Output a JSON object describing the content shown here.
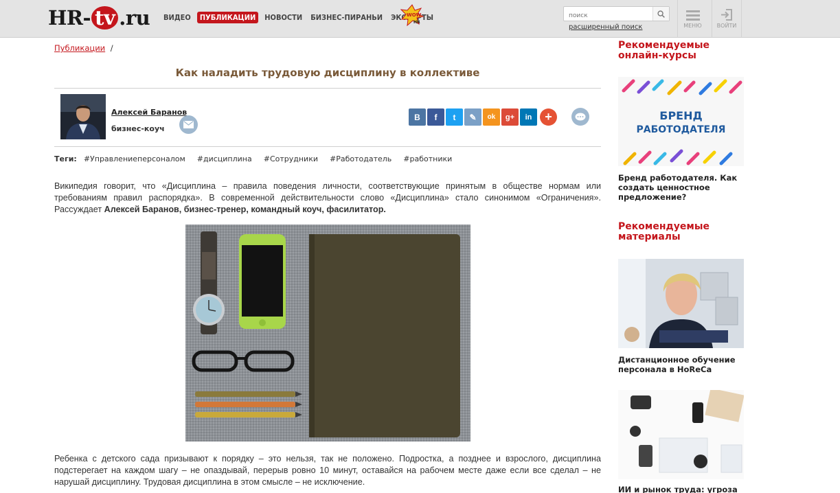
{
  "header": {
    "logo": {
      "left": "HR-",
      "tv": "tv",
      "right": ".ru"
    },
    "nav": [
      {
        "label": "ВИДЕО",
        "active": false
      },
      {
        "label": "ПУБЛИКАЦИИ",
        "active": true
      },
      {
        "label": "НОВОСТИ",
        "active": false
      },
      {
        "label": "БИЗНЕС-ПИРАНЬИ",
        "active": false
      },
      {
        "label": "ЭКСПЕРТЫ",
        "active": false
      }
    ],
    "search_placeholder": "поиск",
    "advanced_search": "расширенный поиск",
    "menu_label": "МЕНЮ",
    "login_label": "ВОЙТИ"
  },
  "breadcrumb": {
    "link": "Публикации",
    "separator": "/"
  },
  "article": {
    "title": "Как наладить трудовую дисциплину в коллективе",
    "author": {
      "name": "Алексей Баранов",
      "role": "бизнес-коуч"
    },
    "share_buttons": [
      {
        "icon": "vk-icon",
        "glyph": "В",
        "color": "#4c75a3"
      },
      {
        "icon": "facebook-icon",
        "glyph": "f",
        "color": "#3b5998"
      },
      {
        "icon": "twitter-icon",
        "glyph": "t",
        "color": "#1da1f2"
      },
      {
        "icon": "livejournal-icon",
        "glyph": "✎",
        "color": "#7ba0c6"
      },
      {
        "icon": "odnoklassniki-icon",
        "glyph": "ok",
        "color": "#f4941e"
      },
      {
        "icon": "googleplus-icon",
        "glyph": "g+",
        "color": "#dc4b38"
      },
      {
        "icon": "linkedin-icon",
        "glyph": "in",
        "color": "#0077b5"
      }
    ],
    "tags_label": "Теги:",
    "tags": [
      "#Управлениеперсоналом",
      "#дисциплина",
      "#Сотрудники",
      "#Работодатель",
      "#работники"
    ],
    "intro_text": "Википедия говорит, что «Дисциплина – правила поведения личности, соответствующие принятым в обществе нормам или требованиям правил распорядка». В современной действительности слово «Дисциплина» стало синонимом «Ограничения». Рассуждает ",
    "intro_bold": "Алексей Баранов, бизнес-тренер, командный коуч, фасилитатор.",
    "second_paragraph": "Ребенка с детского сада призывают к порядку – это нельзя, так не положено. Подростка, а позднее и взрослого, дисциплина подстерегает на каждом шагу – не опаздывай, перерыв ровно 10 минут, оставайся на рабочем месте даже если все сделал – не нарушай дисциплину. Трудовая дисциплина в этом смысле – не исключение."
  },
  "sidebar": {
    "courses_heading": "Рекомендуемые онлайн-курсы",
    "course_banner": {
      "line1": "БРЕНД",
      "line2": "РАБОТОДАТЕЛЯ"
    },
    "course_caption": "Бренд работодателя. Как создать ценностное предложение?",
    "materials_heading": "Рекомендуемые материалы",
    "material1_caption": "Дистанционное обучение персонала в HoReCa",
    "material2_caption": "ИИ и рынок труда: угроза"
  },
  "colors": {
    "brand_red": "#c4161c",
    "title_brown": "#7a5a39"
  }
}
